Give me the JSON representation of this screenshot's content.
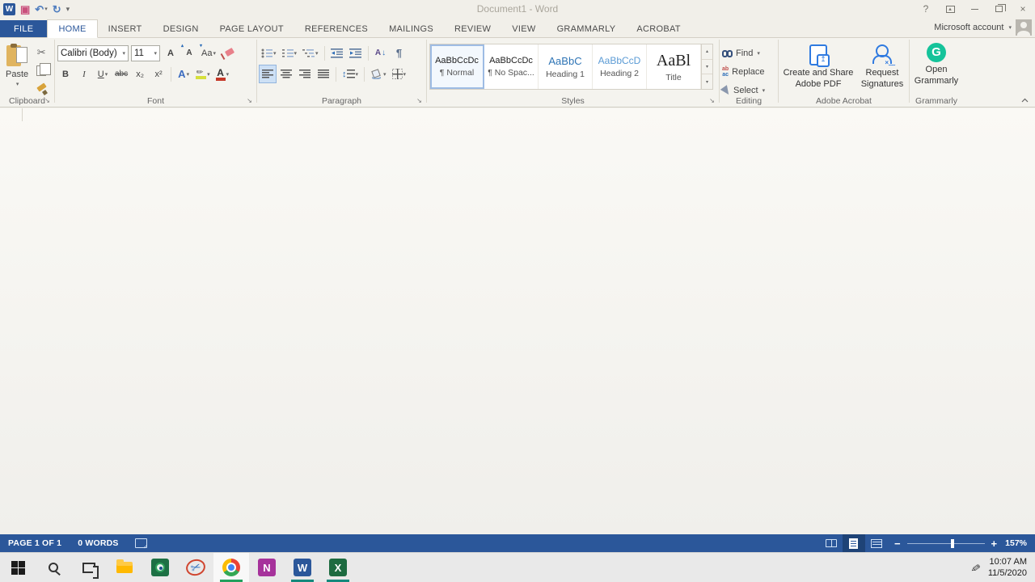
{
  "colors": {
    "accent_blue": "#2b579a",
    "grammarly_green": "#15c39a",
    "chrome_bg": "#f1efe9",
    "ribbon_bg": "#f4f3ee",
    "statusbar_bg": "#2b579a",
    "highlight_yellow": "#d6e03c",
    "font_color_red": "#c53929"
  },
  "icons": {
    "word_logo_letter": "W",
    "undo": "↶",
    "redo": "↻",
    "dropdown": "▾",
    "up_small": "▴",
    "more_gallery": "▾",
    "scissors": "✂",
    "pilcrow": "¶",
    "launcher": "↘",
    "help": "?",
    "close": "×",
    "updown_arrow": "↕",
    "sort_letter": "A",
    "sort_arrow": "↓",
    "replace_top": "ab",
    "replace_bottom": "ac",
    "pen": "✎",
    "onenote_letter": "N",
    "word_letter": "W",
    "excel_letter": "X",
    "grammarly_letter": "G"
  },
  "title_bar": {
    "title": "Document1 - Word"
  },
  "tabs": [
    "FILE",
    "HOME",
    "INSERT",
    "DESIGN",
    "PAGE LAYOUT",
    "REFERENCES",
    "MAILINGS",
    "REVIEW",
    "VIEW",
    "GRAMMARLY",
    "ACROBAT"
  ],
  "account": {
    "label": "Microsoft account"
  },
  "ribbon": {
    "clipboard": {
      "label": "Clipboard",
      "paste": "Paste"
    },
    "font": {
      "label": "Font",
      "font_name": "Calibri (Body)",
      "font_size": "11",
      "grow": "A",
      "shrink": "A",
      "change_case": "Aa",
      "bold": "B",
      "italic": "I",
      "underline": "U",
      "strikethrough": "abc",
      "subscript": "x₂",
      "superscript": "x²",
      "text_effects": "A",
      "font_color": "A"
    },
    "paragraph": {
      "label": "Paragraph"
    },
    "styles": {
      "label": "Styles",
      "items": [
        {
          "preview": "AaBbCcDc",
          "name": "¶ Normal"
        },
        {
          "preview": "AaBbCcDc",
          "name": "¶ No Spac..."
        },
        {
          "preview": "AaBbC",
          "name": "Heading 1"
        },
        {
          "preview": "AaBbCcD",
          "name": "Heading 2"
        },
        {
          "preview": "AaBl",
          "name": "Title"
        }
      ]
    },
    "editing": {
      "label": "Editing",
      "find": "Find",
      "replace": "Replace",
      "select": "Select"
    },
    "acrobat": {
      "label": "Adobe Acrobat",
      "create_share": "Create and Share Adobe PDF",
      "request_signatures": "Request Signatures"
    },
    "grammarly": {
      "label": "Grammarly",
      "open": "Open Grammarly"
    }
  },
  "status_bar": {
    "page": "PAGE 1 OF 1",
    "words": "0 WORDS",
    "zoom_percent": "157%"
  },
  "taskbar": {
    "clock_time": "10:07 AM",
    "clock_date": "11/5/2020"
  }
}
